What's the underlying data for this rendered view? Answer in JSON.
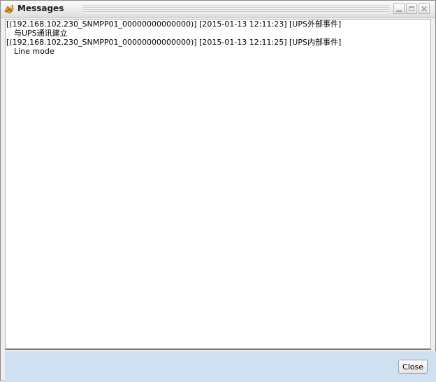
{
  "window": {
    "title": "Messages",
    "icon": "messages-app-icon",
    "controls": {
      "minimize_icon": "minimize-icon",
      "maximize_icon": "maximize-icon",
      "close_icon": "close-icon"
    }
  },
  "messages": [
    {
      "header": "[(192.168.102.230_SNMPP01_00000000000000)] [2015-01-13 12:11:23] [UPS外部事件]",
      "body": "与UPS通讯建立"
    },
    {
      "header": "[(192.168.102.230_SNMPP01_00000000000000)] [2015-01-13 12:11:25] [UPS内部事件]",
      "body": "Line mode"
    }
  ],
  "footer": {
    "close_label": "Close"
  },
  "colors": {
    "footer_bg": "#cfe1f1",
    "content_bg": "#ffffff",
    "titlebar_bg": "#ececec"
  }
}
